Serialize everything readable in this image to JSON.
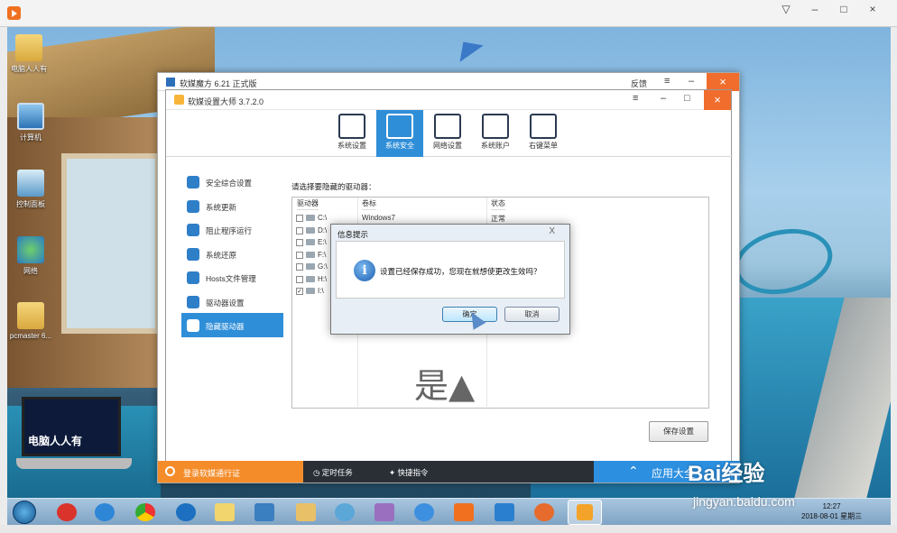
{
  "player": {
    "controls": [
      "▽",
      "–",
      "□",
      "×"
    ]
  },
  "desktop": {
    "icons": [
      {
        "label": "电脑人人有"
      },
      {
        "label": "计算机"
      },
      {
        "label": "控制面板"
      },
      {
        "label": "网络"
      },
      {
        "label": "pcmaster 6..."
      }
    ],
    "laptop_brand": "电脑人人有"
  },
  "outer_window": {
    "title": "软媒魔方 6.21 正式版",
    "feedback": "反馈",
    "menu": "≡",
    "minimize": "–",
    "close": "×"
  },
  "inner_window": {
    "title": "软媒设置大师 3.7.2.0",
    "menu": "≡",
    "minimize": "–",
    "maximize": "□",
    "close": "×"
  },
  "tabs": [
    {
      "label": "系统设置",
      "active": false
    },
    {
      "label": "系统安全",
      "active": true
    },
    {
      "label": "网络设置",
      "active": false
    },
    {
      "label": "系统账户",
      "active": false
    },
    {
      "label": "右键菜单",
      "active": false
    }
  ],
  "nav": [
    {
      "label": "安全综合设置",
      "icon": "shield-icon"
    },
    {
      "label": "系统更新",
      "icon": "refresh-icon"
    },
    {
      "label": "阻止程序运行",
      "icon": "block-icon"
    },
    {
      "label": "系统还原",
      "icon": "restore-icon"
    },
    {
      "label": "Hosts文件管理",
      "icon": "hosts-icon"
    },
    {
      "label": "驱动器设置",
      "icon": "drive-icon"
    },
    {
      "label": "隐藏驱动器",
      "icon": "hide-drive-icon"
    }
  ],
  "panel": {
    "title": "请选择要隐藏的驱动器：",
    "columns": [
      "驱动器",
      "卷标",
      "状态"
    ],
    "drives": [
      {
        "drive": "C:\\",
        "label": "Windows7",
        "status": "正常",
        "checked": false
      },
      {
        "drive": "D:\\",
        "label": "",
        "status": "",
        "checked": false
      },
      {
        "drive": "E:\\",
        "label": "",
        "status": "",
        "checked": false
      },
      {
        "drive": "F:\\",
        "label": "",
        "status": "",
        "checked": false
      },
      {
        "drive": "G:\\",
        "label": "",
        "status": "",
        "checked": false
      },
      {
        "drive": "H:\\",
        "label": "",
        "status": "",
        "checked": false
      },
      {
        "drive": "I:\\",
        "label": "",
        "status": "",
        "checked": true
      }
    ],
    "overlay_text": "是▲",
    "save_button": "保存设置"
  },
  "footer": {
    "login": "登录软媒通行证",
    "timer": "定时任务",
    "shortcut": "快捷指令",
    "apps": "应用大全"
  },
  "dialog": {
    "title": "信息提示",
    "close": "X",
    "message": "设置已经保存成功，您现在就想使更改生效吗？",
    "ok": "确定",
    "cancel": "取消"
  },
  "taskbar": {
    "date": "2018-08-01 星期三",
    "time": "12:27"
  },
  "watermark": {
    "brand": "Bai经验",
    "url": "jingyan.baidu.com"
  }
}
